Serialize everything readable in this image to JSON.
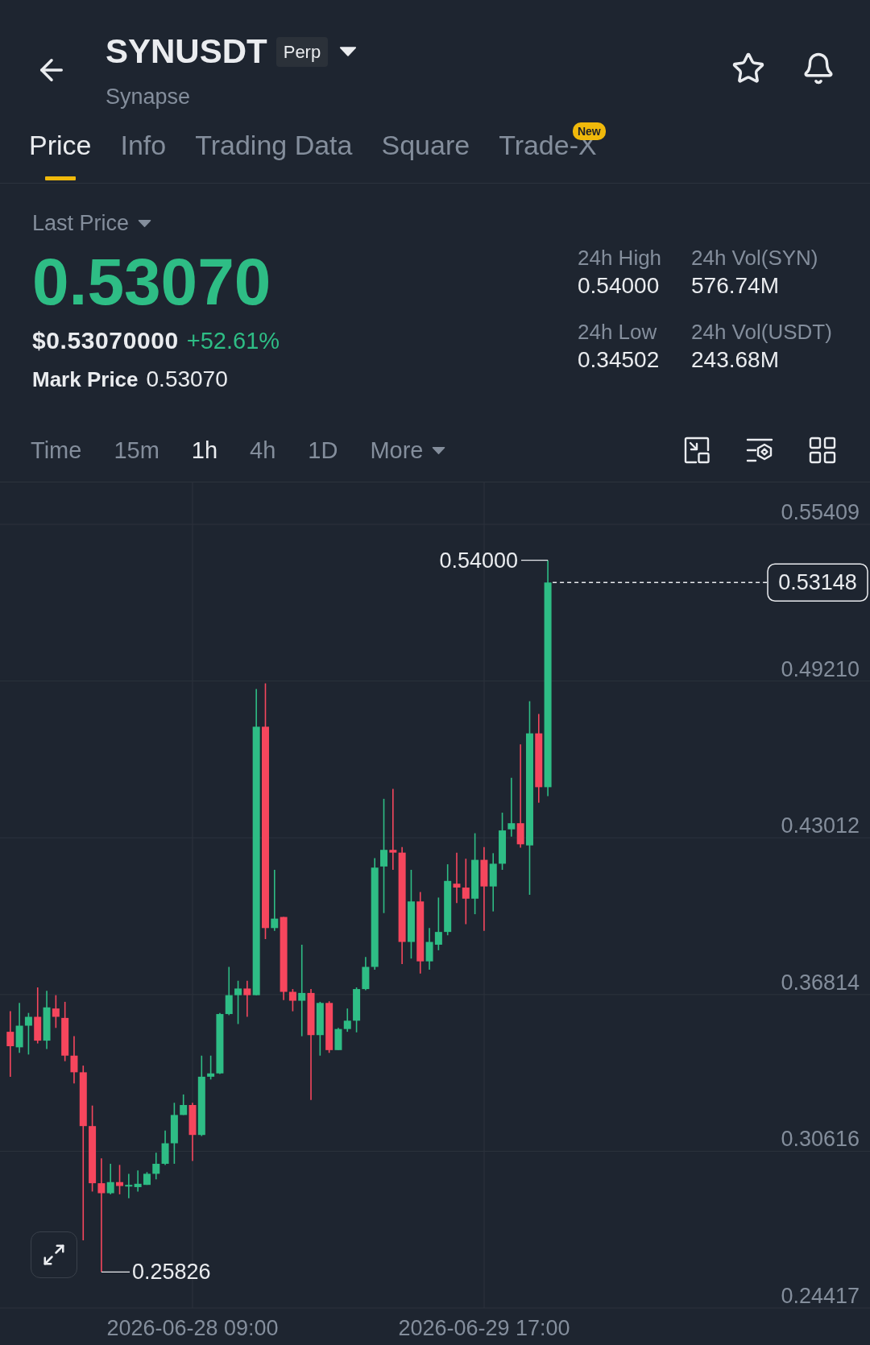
{
  "header": {
    "title": "SYNUSDT",
    "badge": "Perp",
    "subtitle": "Synapse"
  },
  "tabs": [
    {
      "label": "Price",
      "selected": true
    },
    {
      "label": "Info",
      "selected": false
    },
    {
      "label": "Trading Data",
      "selected": false
    },
    {
      "label": "Square",
      "selected": false
    },
    {
      "label": "Trade-X",
      "selected": false,
      "badge": "New"
    }
  ],
  "price": {
    "selector": "Last Price",
    "last": "0.53070",
    "rising": true,
    "usd": "$0.53070000",
    "change": "+52.61%",
    "mark_label": "Mark Price",
    "mark_value": "0.53070"
  },
  "stats": [
    {
      "label": "24h High",
      "value": "0.54000"
    },
    {
      "label": "24h Vol(SYN)",
      "value": "576.74M"
    },
    {
      "label": "24h Low",
      "value": "0.34502"
    },
    {
      "label": "24h Vol(USDT)",
      "value": "243.68M"
    }
  ],
  "intervals": [
    {
      "label": "Time",
      "kind": "option",
      "selected": false
    },
    {
      "label": "15m",
      "kind": "option",
      "selected": false
    },
    {
      "label": "1h",
      "kind": "option",
      "selected": true
    },
    {
      "label": "4h",
      "kind": "option",
      "selected": false
    },
    {
      "label": "1D",
      "kind": "option",
      "selected": false
    },
    {
      "label": "More",
      "kind": "menu",
      "selected": false
    }
  ],
  "chart": {
    "price_axis": [
      "0.55409",
      "0.49210",
      "0.43012",
      "0.36814",
      "0.30616",
      "0.24417"
    ],
    "high_label": "0.54000",
    "low_label": "0.25826",
    "current_price": "0.53148",
    "time_axis": [
      "2026-06-28 09:00",
      "2026-06-29 17:00"
    ]
  }
}
